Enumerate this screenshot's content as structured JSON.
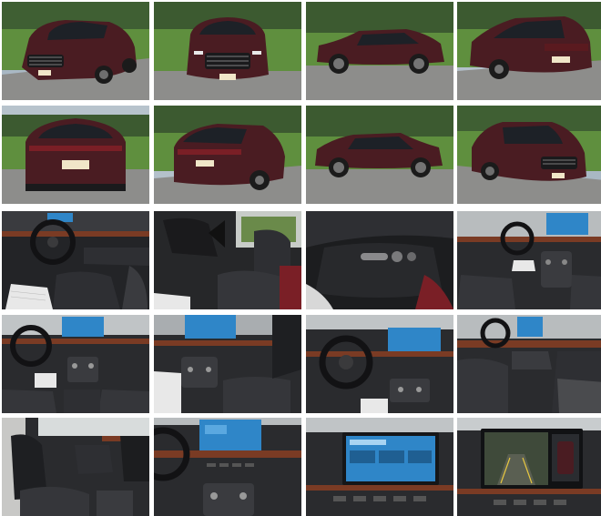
{
  "colors": {
    "vehicle_body": "#4a1c22",
    "grass": "#5f8f3e",
    "pavement": "#8d8d8b",
    "interior_dark": "#232427",
    "leather": "#2e2f33",
    "wood_trim": "#7a3b24",
    "screen": "#2f86c8"
  },
  "gallery": {
    "photos": [
      {
        "subject": "front-three-quarter-left"
      },
      {
        "subject": "front"
      },
      {
        "subject": "side-left"
      },
      {
        "subject": "rear-three-quarter-left"
      },
      {
        "subject": "rear"
      },
      {
        "subject": "rear-three-quarter-right"
      },
      {
        "subject": "side-right"
      },
      {
        "subject": "front-three-quarter-right"
      },
      {
        "subject": "driver-cockpit"
      },
      {
        "subject": "driver-seat"
      },
      {
        "subject": "seat-controls"
      },
      {
        "subject": "dashboard-passenger-view"
      },
      {
        "subject": "dashboard-center"
      },
      {
        "subject": "center-console"
      },
      {
        "subject": "steering-wheel-display"
      },
      {
        "subject": "passenger-dashboard"
      },
      {
        "subject": "front-seats-side"
      },
      {
        "subject": "center-stack"
      },
      {
        "subject": "infotainment-screen"
      },
      {
        "subject": "backup-camera-screen"
      }
    ]
  }
}
